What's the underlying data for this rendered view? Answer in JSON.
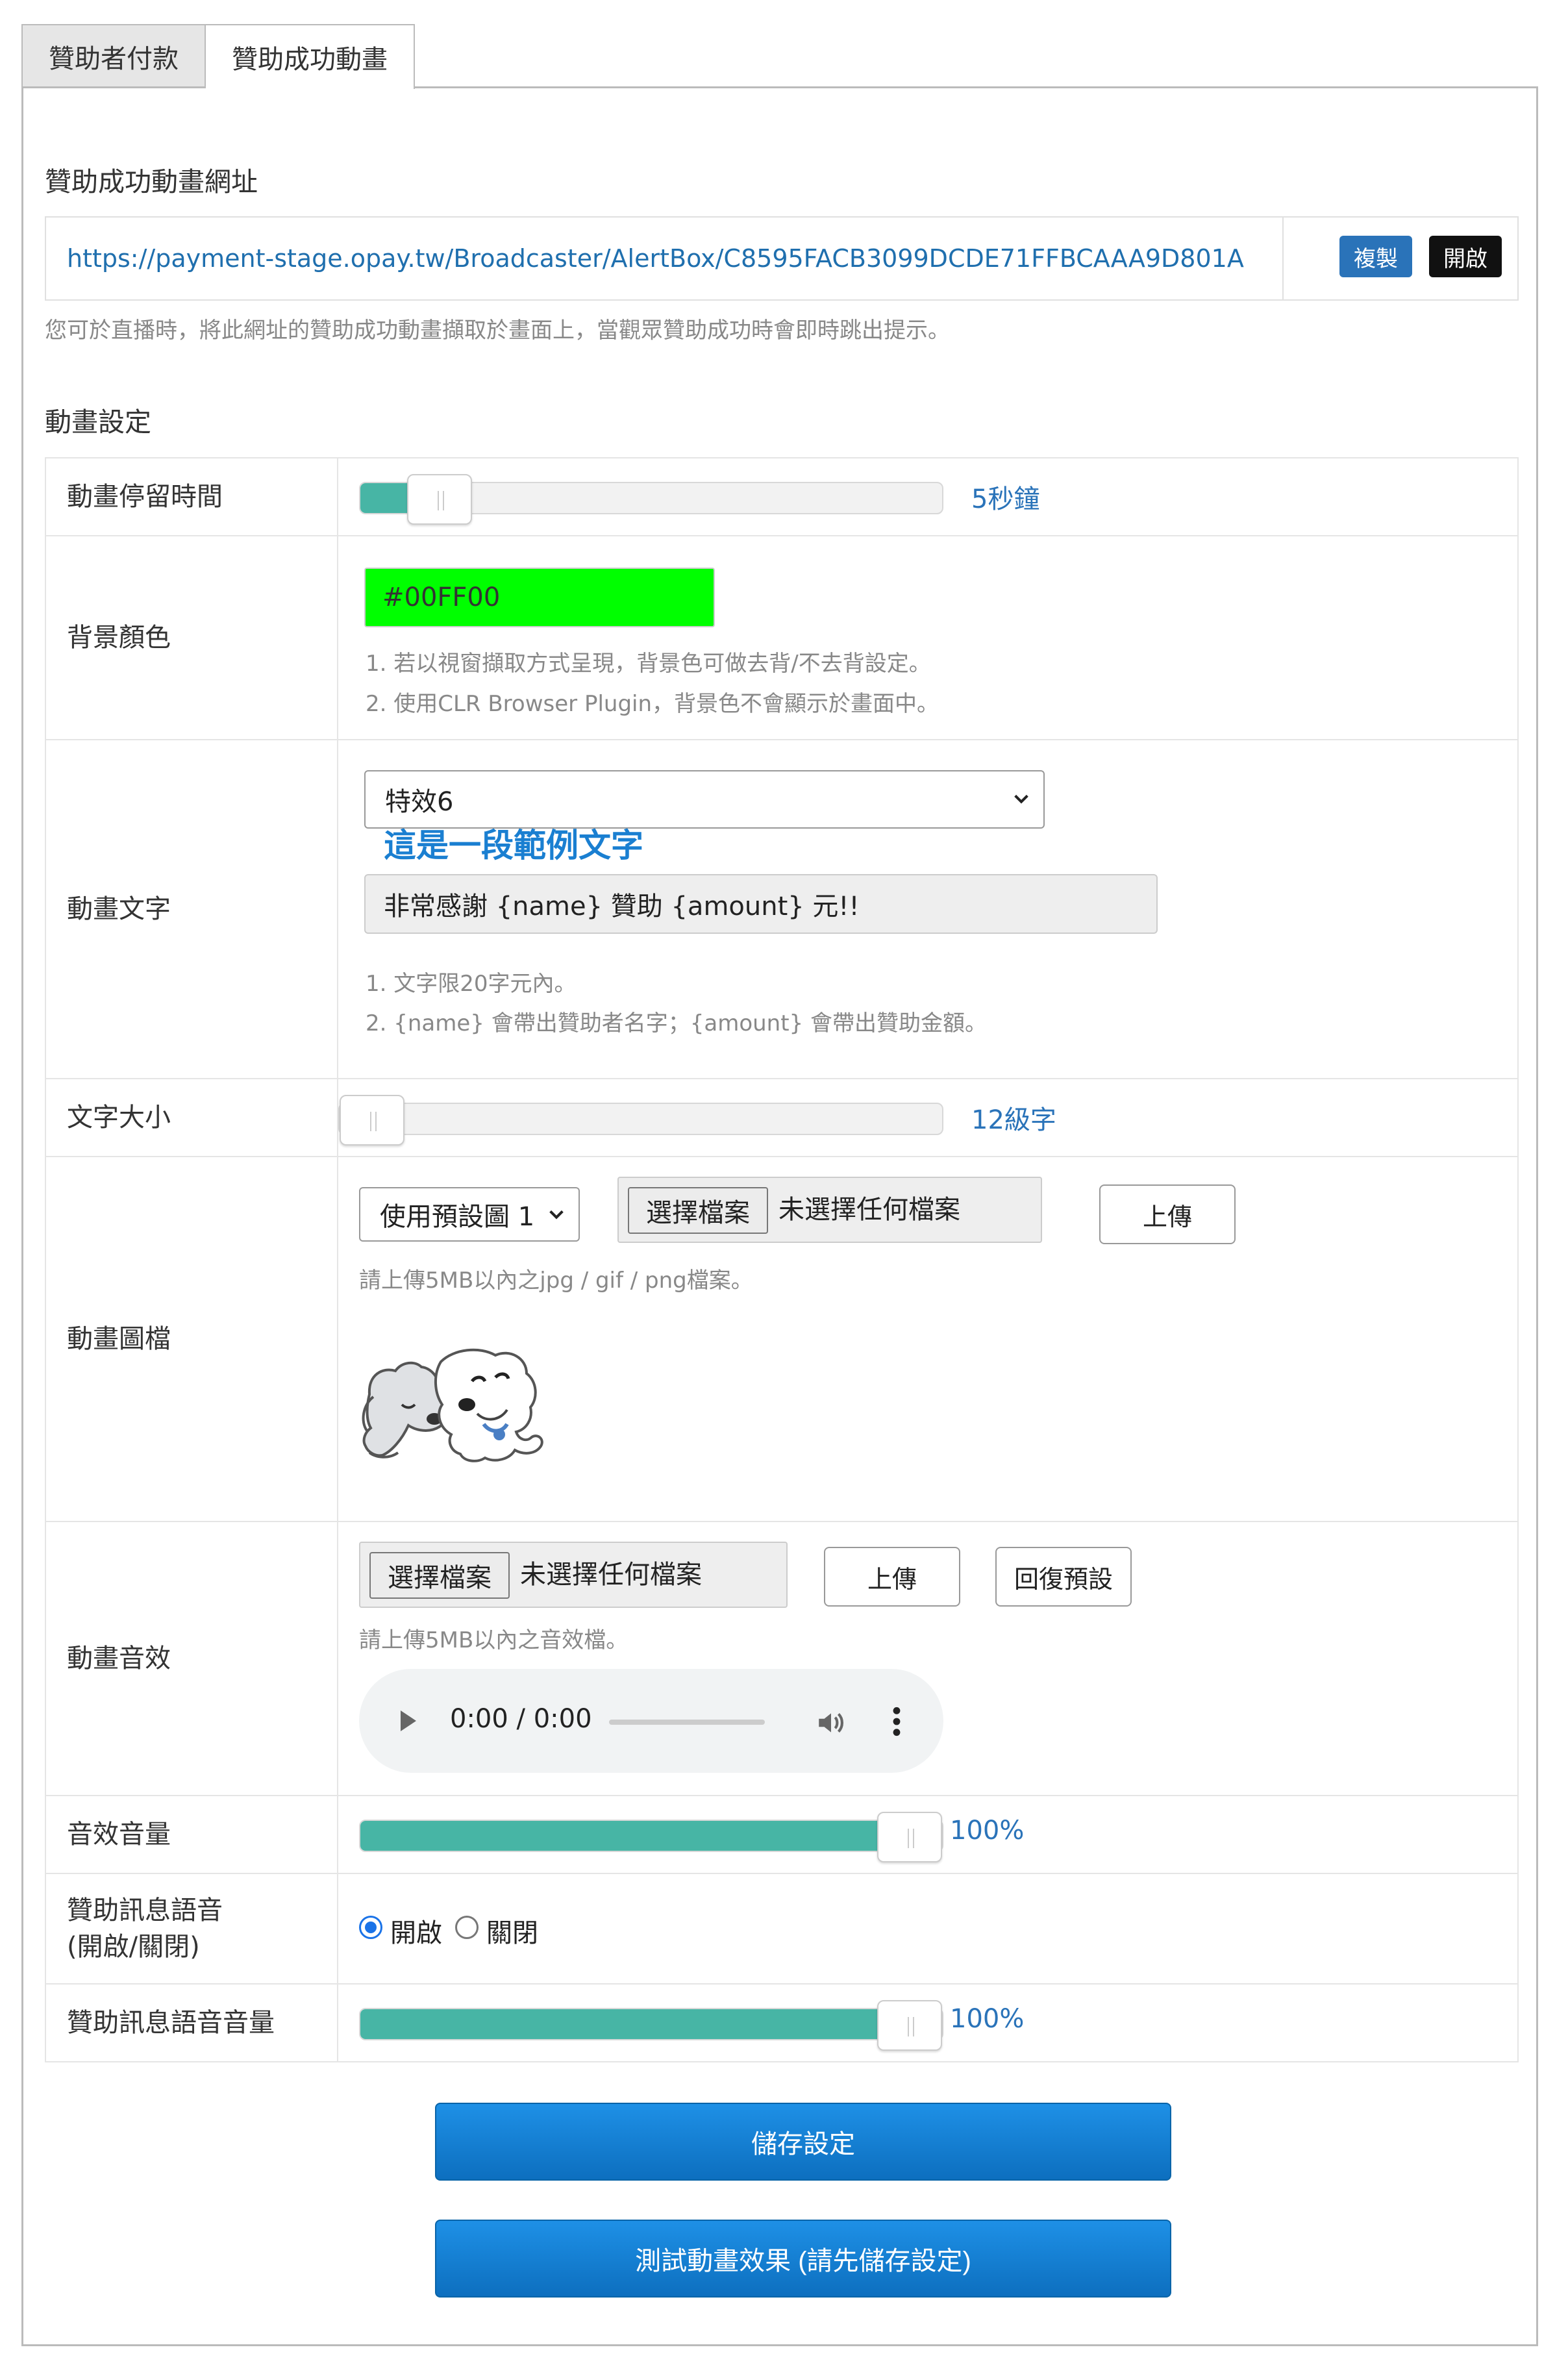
{
  "tabs": [
    {
      "label": "贊助者付款",
      "active": false
    },
    {
      "label": "贊助成功動畫",
      "active": true
    }
  ],
  "url_section": {
    "title": "贊助成功動畫網址",
    "url": "https://payment-stage.opay.tw/Broadcaster/AlertBox/C8595FACB3099DCDE71FFBCAAA9D801A",
    "copy_label": "複製",
    "open_label": "開啟",
    "hint": "您可於直播時，將此網址的贊助成功動畫擷取於畫面上，當觀眾贊助成功時會即時跳出提示。"
  },
  "settings_title": "動畫設定",
  "settings": {
    "duration": {
      "label": "動畫停留時間",
      "value_label": "5秒鐘",
      "fraction": 0.09
    },
    "background": {
      "label": "背景顏色",
      "value": "#00FF00",
      "color": "#00ff00",
      "hints": [
        "1. 若以視窗擷取方式呈現，背景色可做去背/不去背設定。",
        "2. 使用CLR Browser Plugin，背景色不會顯示於畫面中。"
      ]
    },
    "text": {
      "label": "動畫文字",
      "effect": "特效6",
      "sample": "這是一段範例文字",
      "value": "非常感謝 {name} 贊助 {amount} 元!!",
      "hints": [
        "1. 文字限20字元內。",
        "2. {name} 會帶出贊助者名字；{amount} 會帶出贊助金額。"
      ]
    },
    "font_size": {
      "label": "文字大小",
      "value_label": "12級字",
      "fraction": 0.0
    },
    "image": {
      "label": "動畫圖檔",
      "preset": "使用預設圖 1",
      "choose_label": "選擇檔案",
      "file_status": "未選擇任何檔案",
      "upload_label": "上傳",
      "hint": "請上傳5MB以內之jpg / gif / png檔案。"
    },
    "sound": {
      "label": "動畫音效",
      "choose_label": "選擇檔案",
      "file_status": "未選擇任何檔案",
      "upload_label": "上傳",
      "reset_label": "回復預設",
      "hint": "請上傳5MB以內之音效檔。",
      "time": "0:00 / 0:00"
    },
    "volume": {
      "label": "音效音量",
      "value_label": "100%",
      "fraction": 1.0
    },
    "voice": {
      "label_line1": "贊助訊息語音",
      "label_line2": "(開啟/關閉)",
      "on_label": "開啟",
      "off_label": "關閉",
      "selected": "on"
    },
    "voice_volume": {
      "label": "贊助訊息語音音量",
      "value_label": "100%",
      "fraction": 1.0
    }
  },
  "save_label": "儲存設定",
  "test_label": "測試動畫效果 (請先儲存設定)",
  "colors": {
    "accent": "#2a73b9",
    "slider": "#47b5a5",
    "button": "#1a80d6"
  }
}
